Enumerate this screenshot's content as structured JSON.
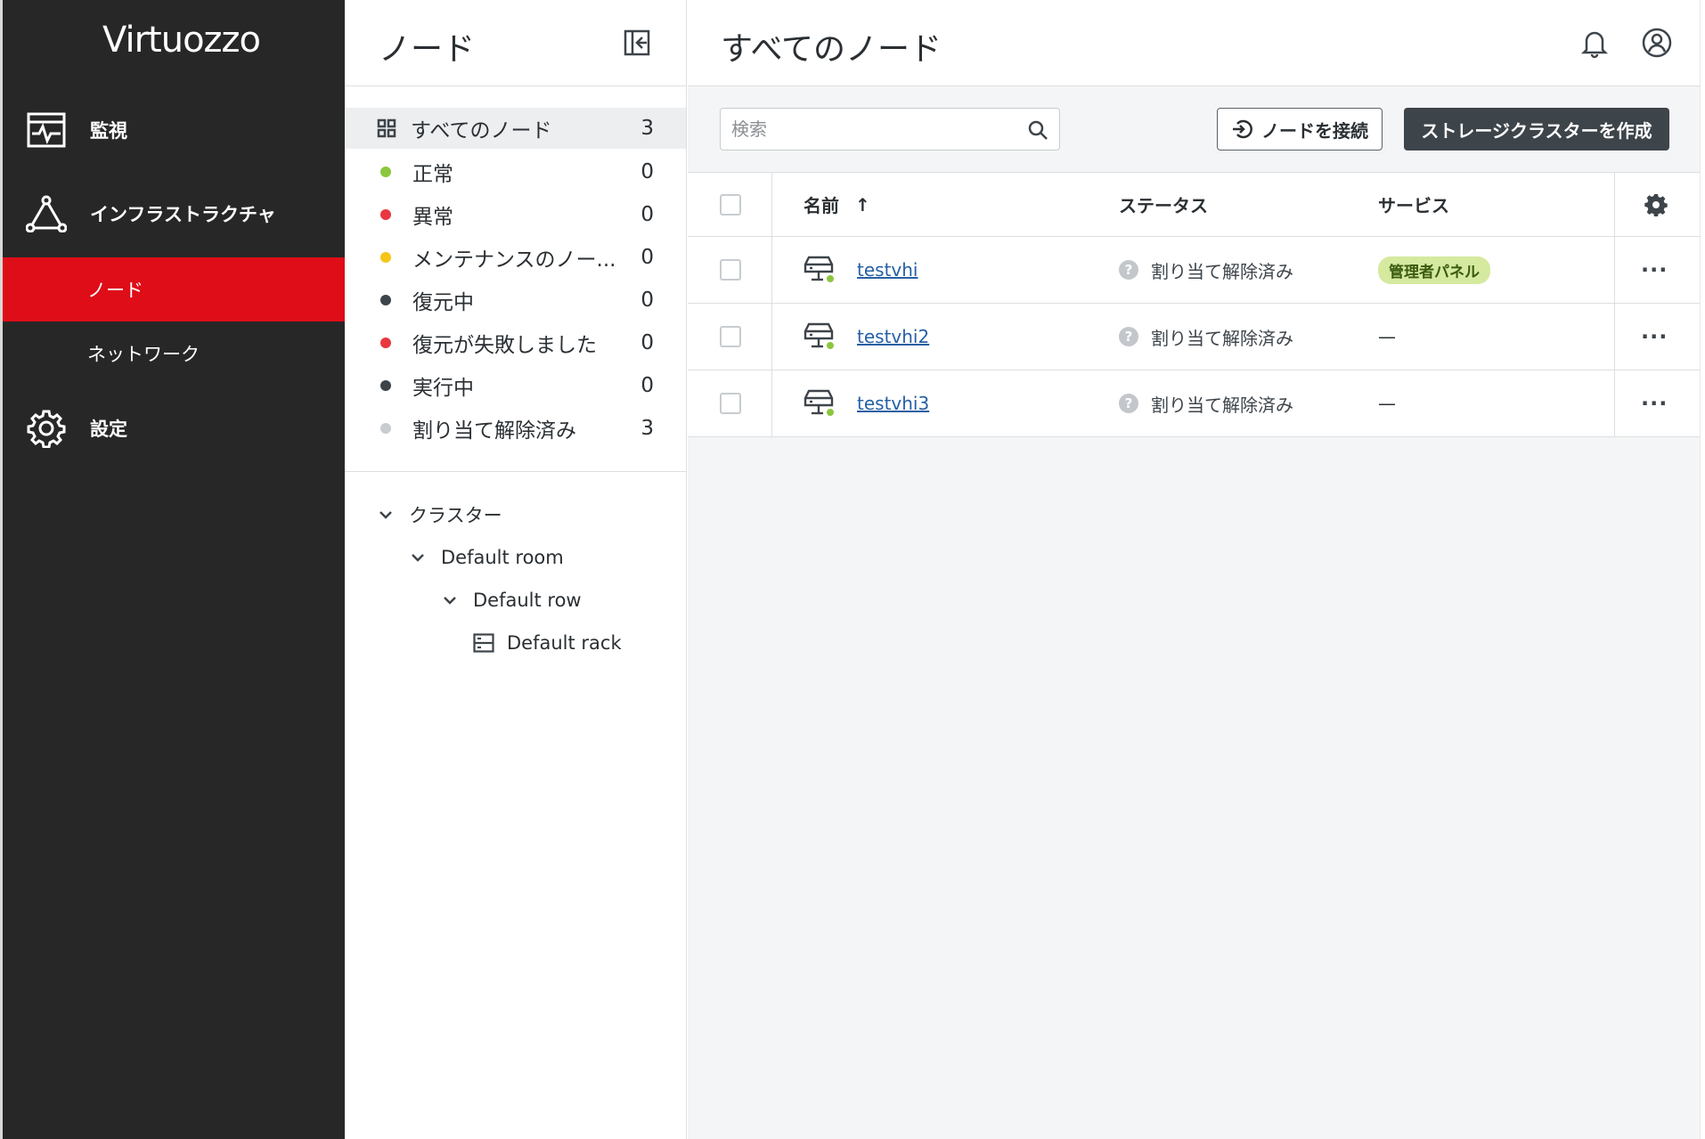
{
  "nav": {
    "logo": "Virtuozzo",
    "items": [
      {
        "label": "監視",
        "icon": "monitoring-icon"
      },
      {
        "label": "インフラストラクチャ",
        "icon": "infrastructure-icon"
      },
      {
        "label": "設定",
        "icon": "settings-gear-icon"
      }
    ],
    "sub_items": [
      {
        "label": "ノード",
        "active": true
      },
      {
        "label": "ネットワーク",
        "active": false
      }
    ]
  },
  "mid": {
    "title": "ノード",
    "filters": [
      {
        "label": "すべてのノード",
        "count": "3",
        "color": null
      },
      {
        "label": "正常",
        "count": "0",
        "color": "#8cc63f"
      },
      {
        "label": "異常",
        "count": "0",
        "color": "#e8373f"
      },
      {
        "label": "メンテナンスのノー...",
        "count": "0",
        "color": "#f5c518"
      },
      {
        "label": "復元中",
        "count": "0",
        "color": "#3d444a"
      },
      {
        "label": "復元が失敗しました",
        "count": "0",
        "color": "#e8373f"
      },
      {
        "label": "実行中",
        "count": "0",
        "color": "#3d444a"
      },
      {
        "label": "割り当て解除済み",
        "count": "3",
        "color": "#c8ccd0"
      }
    ],
    "tree": [
      {
        "label": "クラスター"
      },
      {
        "label": "Default room"
      },
      {
        "label": "Default row"
      },
      {
        "label": "Default rack"
      }
    ]
  },
  "main": {
    "title": "すべてのノード",
    "search_placeholder": "検索",
    "connect_button": "ノードを接続",
    "create_button": "ストレージクラスターを作成",
    "columns": {
      "name": "名前",
      "status": "ステータス",
      "services": "サービス"
    },
    "rows": [
      {
        "name": "testvhi",
        "status": "割り当て解除済み",
        "service": "管理者パネル",
        "service_is_tag": true
      },
      {
        "name": "testvhi2",
        "status": "割り当て解除済み",
        "service": "—",
        "service_is_tag": false
      },
      {
        "name": "testvhi3",
        "status": "割り当て解除済み",
        "service": "—",
        "service_is_tag": false
      }
    ],
    "status_icon_glyph": "?",
    "more_glyph": "···",
    "sort_glyph": "↑"
  },
  "colors": {
    "nav_bg": "#272727",
    "nav_active": "#de0d18",
    "tag_bg": "#d5ea9f",
    "link": "#2660a4",
    "online_dot": "#8cc63f"
  }
}
